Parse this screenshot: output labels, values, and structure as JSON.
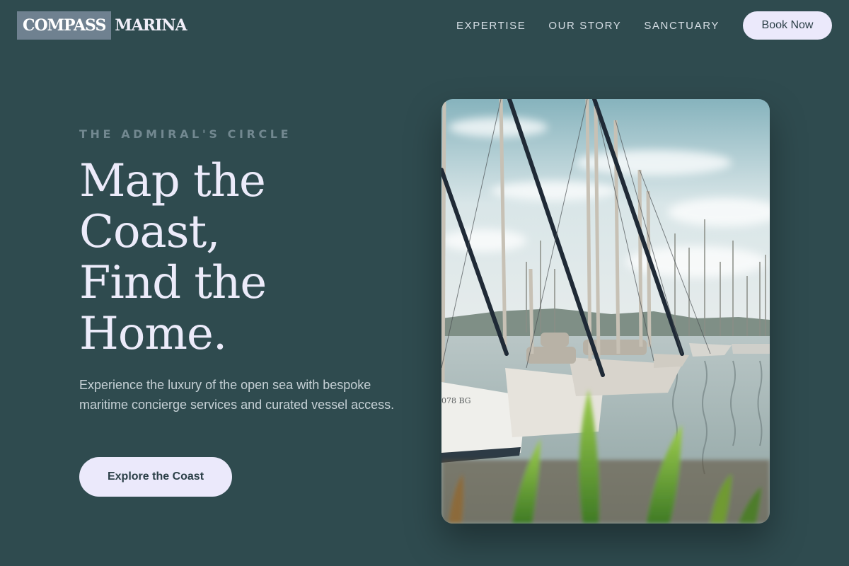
{
  "brand": {
    "word_1": "COMPASS",
    "word_2": "MARINA"
  },
  "nav": {
    "items": [
      {
        "label": "EXPERTISE"
      },
      {
        "label": "OUR STORY"
      },
      {
        "label": "SANCTUARY"
      }
    ],
    "cta_label": "Book Now"
  },
  "hero": {
    "kicker": "THE ADMIRAL'S CIRCLE",
    "headline_lines": [
      "Map the",
      "Coast,",
      "Find the",
      "Home."
    ],
    "description": "Experience the luxury of the open sea with bespoke maritime concierge services and curated vessel access.",
    "cta_label": "Explore the Coast",
    "image": {
      "subject": "sailboats moored at a marina with reeds in the foreground",
      "hull_text": "078 BG"
    }
  },
  "colors": {
    "background": "#2f4b4f",
    "logo_box": "#6f8190",
    "button_bg": "#ebe9fb",
    "button_text": "#2b3f47",
    "headline": "#ecebfa",
    "kicker": "#728890",
    "body_text": "#c6d1d6",
    "nav_text": "#d7dfe6"
  }
}
